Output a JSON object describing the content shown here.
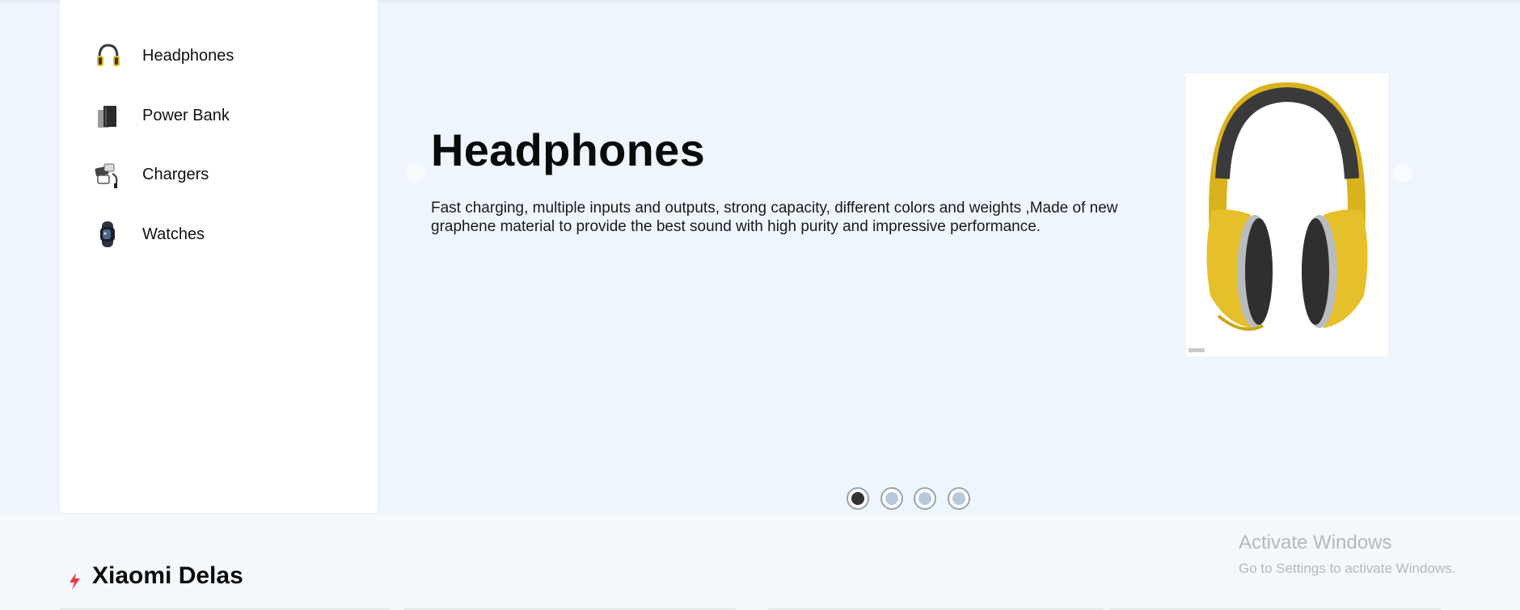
{
  "sidebar": {
    "items": [
      {
        "label": "Headphones",
        "icon": "headphones-icon"
      },
      {
        "label": "Power Bank",
        "icon": "power-bank-icon"
      },
      {
        "label": "Chargers",
        "icon": "chargers-icon"
      },
      {
        "label": "Watches",
        "icon": "watch-icon"
      }
    ]
  },
  "hero": {
    "title": "Headphones",
    "description": "Fast charging, multiple inputs and outputs, strong capacity, different colors and weights ,Made of new graphene material to provide the best sound with high purity and impressive performance.",
    "prev_icon": "chevron-left-icon",
    "next_icon": "chevron-right-icon",
    "slides": 4,
    "active_slide": 1
  },
  "deals": {
    "title": "Xiaomi Delas",
    "icon": "lightning-icon"
  },
  "watermark": {
    "line1": "Activate Windows",
    "line2": "Go to Settings to activate Windows."
  },
  "colors": {
    "hero_bg": "#eef5fd",
    "accent": "#e63950",
    "headphone_yellow": "#e8c225"
  }
}
